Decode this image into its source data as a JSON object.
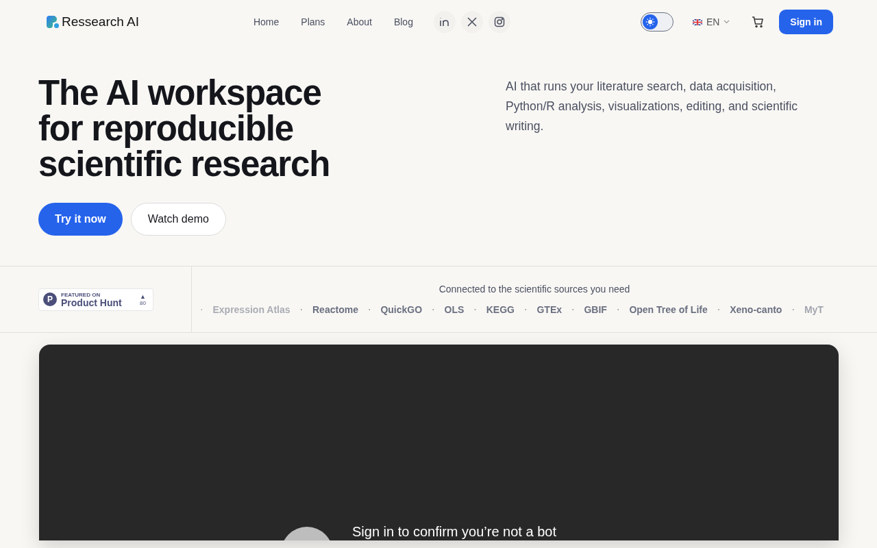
{
  "header": {
    "logo": "Ressearch AI",
    "nav": [
      "Home",
      "Plans",
      "About",
      "Blog"
    ],
    "social": [
      {
        "kind": "linkedin"
      },
      {
        "kind": "x"
      },
      {
        "kind": "instagram"
      }
    ],
    "theme_toggle": {
      "dark": false
    },
    "language": "EN",
    "sign_in": "Sign in"
  },
  "hero": {
    "title": "The AI workspace for reproducible scientific research",
    "description": "AI that runs your literature search, data acquisition, Python/R analysis, visualizations, editing, and scientific writing.",
    "primary_button": "Try it now",
    "secondary_button": "Watch demo"
  },
  "badge": {
    "small": "FEATURED ON",
    "name": "Product Hunt",
    "letter": "P",
    "arrow": "▲",
    "count": "80"
  },
  "sources": {
    "heading": "Connected to the scientific sources you need",
    "separator": "·",
    "items": [
      "Expression Atlas",
      "Reactome",
      "QuickGO",
      "OLS",
      "KEGG",
      "GTEx",
      "GBIF",
      "Open Tree of Life",
      "Xeno-canto",
      "MyT"
    ]
  },
  "video": {
    "message": "Sign in to confirm you’re not a bot"
  }
}
